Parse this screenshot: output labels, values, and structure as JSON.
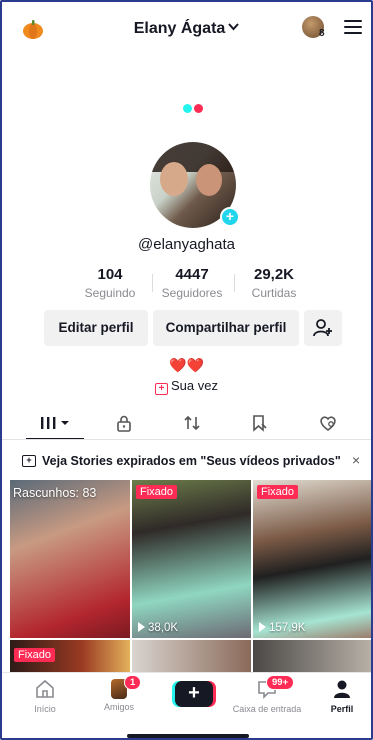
{
  "header": {
    "title": "Elany Ágata",
    "friends_count": "8",
    "icons": [
      "pumpkin-icon",
      "chevron-down-icon",
      "friends-avatar",
      "menu-icon"
    ]
  },
  "profile": {
    "handle": "@elanyaghata",
    "stats": [
      {
        "value": "104",
        "label": "Seguindo"
      },
      {
        "value": "4447",
        "label": "Seguidores"
      },
      {
        "value": "29,2K",
        "label": "Curtidas"
      }
    ],
    "buttons": {
      "edit": "Editar perfil",
      "share": "Compartilhar perfil"
    },
    "bio_hearts": "❤️❤️",
    "story_link": "Sua vez"
  },
  "tabs": [
    "videos",
    "private",
    "reposts",
    "favorites",
    "liked"
  ],
  "banner": {
    "text": "Veja Stories expirados em \"Seus vídeos privados\"",
    "close": "×"
  },
  "grid": {
    "drafts_label": "Rascunhos: 83",
    "pinned_label": "Fixado",
    "video_views": [
      "38,0K",
      "157,9K"
    ]
  },
  "nav": {
    "home": "Início",
    "friends": "Amigos",
    "friends_badge": "1",
    "create": "+",
    "inbox": "Caixa de entrada",
    "inbox_badge": "99+",
    "profile": "Perfil"
  },
  "colors": {
    "accent_red": "#fe2c55",
    "accent_cyan": "#25f4ee",
    "text_dark": "#161823"
  }
}
